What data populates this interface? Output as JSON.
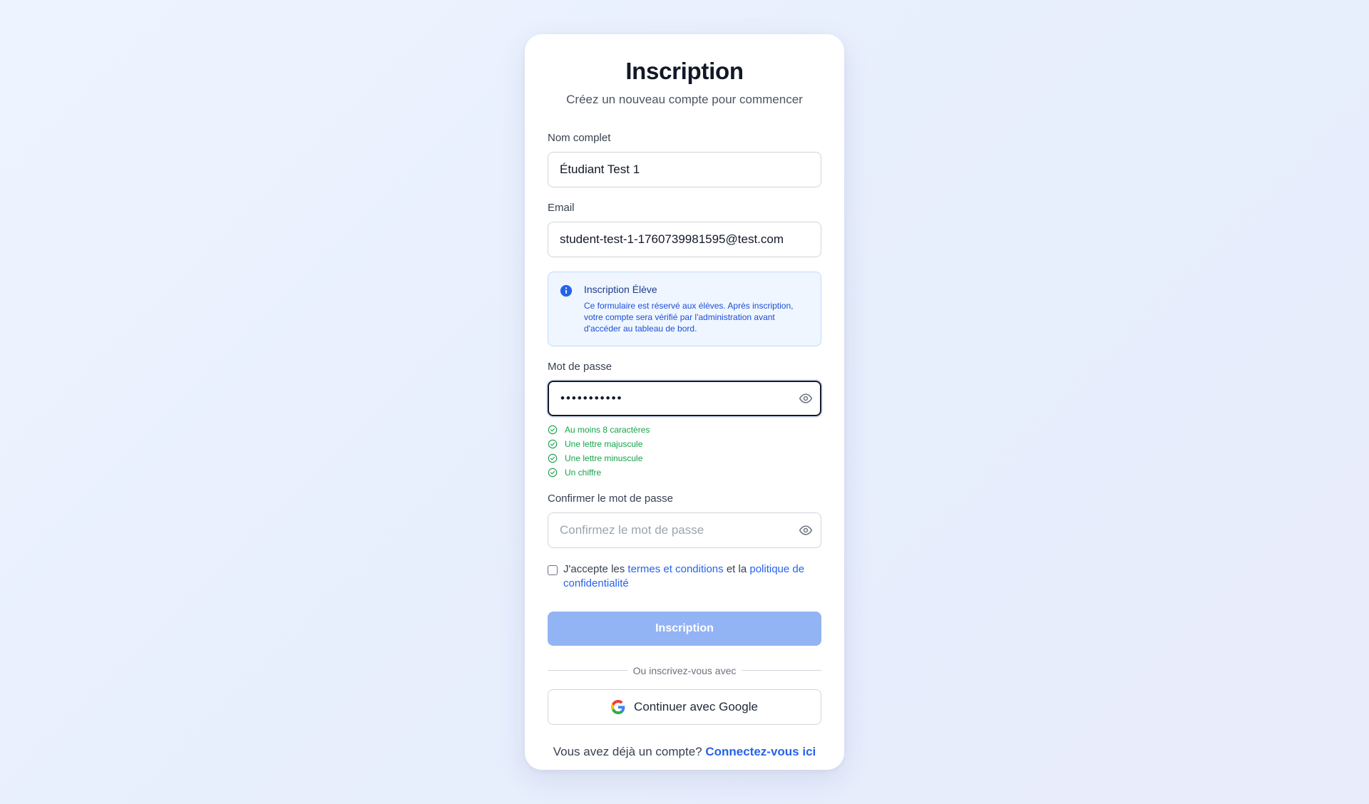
{
  "page": {
    "title": "Inscription",
    "subtitle": "Créez un nouveau compte pour commencer"
  },
  "form": {
    "name": {
      "label": "Nom complet",
      "value": "Étudiant Test 1"
    },
    "email": {
      "label": "Email",
      "value": "student-test-1-1760739981595@test.com"
    },
    "info": {
      "icon": "info-circle-icon",
      "title": "Inscription Élève",
      "text": "Ce formulaire est réservé aux élèves. Après inscription, votre compte sera vérifié par l'administration avant d'accéder au tableau de bord.",
      "color": "#2563eb"
    },
    "password": {
      "label": "Mot de passe",
      "value": "Password123",
      "toggle_icon": "eye-icon",
      "requirements": [
        {
          "text": "Au moins 8 caractères",
          "met": true
        },
        {
          "text": "Une lettre majuscule",
          "met": true
        },
        {
          "text": "Une lettre minuscule",
          "met": true
        },
        {
          "text": "Un chiffre",
          "met": true
        }
      ],
      "met_color": "#16a34a"
    },
    "confirm": {
      "label": "Confirmer le mot de passe",
      "placeholder": "Confirmez le mot de passe",
      "toggle_icon": "eye-icon"
    },
    "terms": {
      "prefix": "J'accepte les",
      "terms_link": "termes et conditions",
      "middle": "et la",
      "privacy_link": "politique de confidentialité",
      "checked": false
    },
    "submit_label": "Inscription"
  },
  "social": {
    "divider": "Ou inscrivez-vous avec",
    "google_label": "Continuer avec Google",
    "google_icon": "google-icon"
  },
  "footer": {
    "text": "Vous avez déjà un compte?",
    "link": "Connectez-vous ici"
  },
  "colors": {
    "accent": "#2563eb",
    "submit_disabled": "#93b4f4"
  }
}
